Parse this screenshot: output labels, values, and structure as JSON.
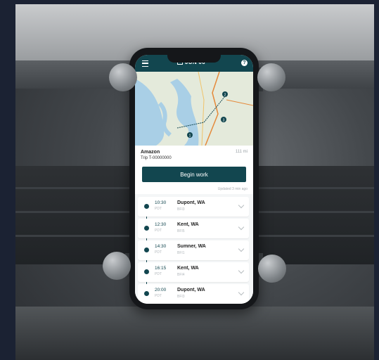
{
  "app": {
    "header": {
      "date": "JUN 06",
      "menu_icon": "menu-icon",
      "help_icon": "help-icon",
      "help_glyph": "?"
    },
    "trip": {
      "company": "Amazon",
      "trip_id": "Trip T-00000000",
      "distance": "111 mi"
    },
    "begin_label": "Begin work",
    "updated_text": "Updated 3 min ago",
    "map_markers": [
      "2",
      "3",
      "1"
    ],
    "stops": [
      {
        "time": "10:30",
        "tz": "PDT",
        "city": "Dupont, WA",
        "code": "BFI3"
      },
      {
        "time": "12:30",
        "tz": "PDT",
        "city": "Kent, WA",
        "code": "BFI5"
      },
      {
        "time": "14:30",
        "tz": "PDT",
        "city": "Sumner, WA",
        "code": "BFI1"
      },
      {
        "time": "16:15",
        "tz": "PDT",
        "city": "Kent, WA",
        "code": "BFI4"
      },
      {
        "time": "20:00",
        "tz": "PDT",
        "city": "Dupont, WA",
        "code": "BFI3"
      }
    ]
  },
  "colors": {
    "brand": "#12464f",
    "background": "#1b2233"
  }
}
